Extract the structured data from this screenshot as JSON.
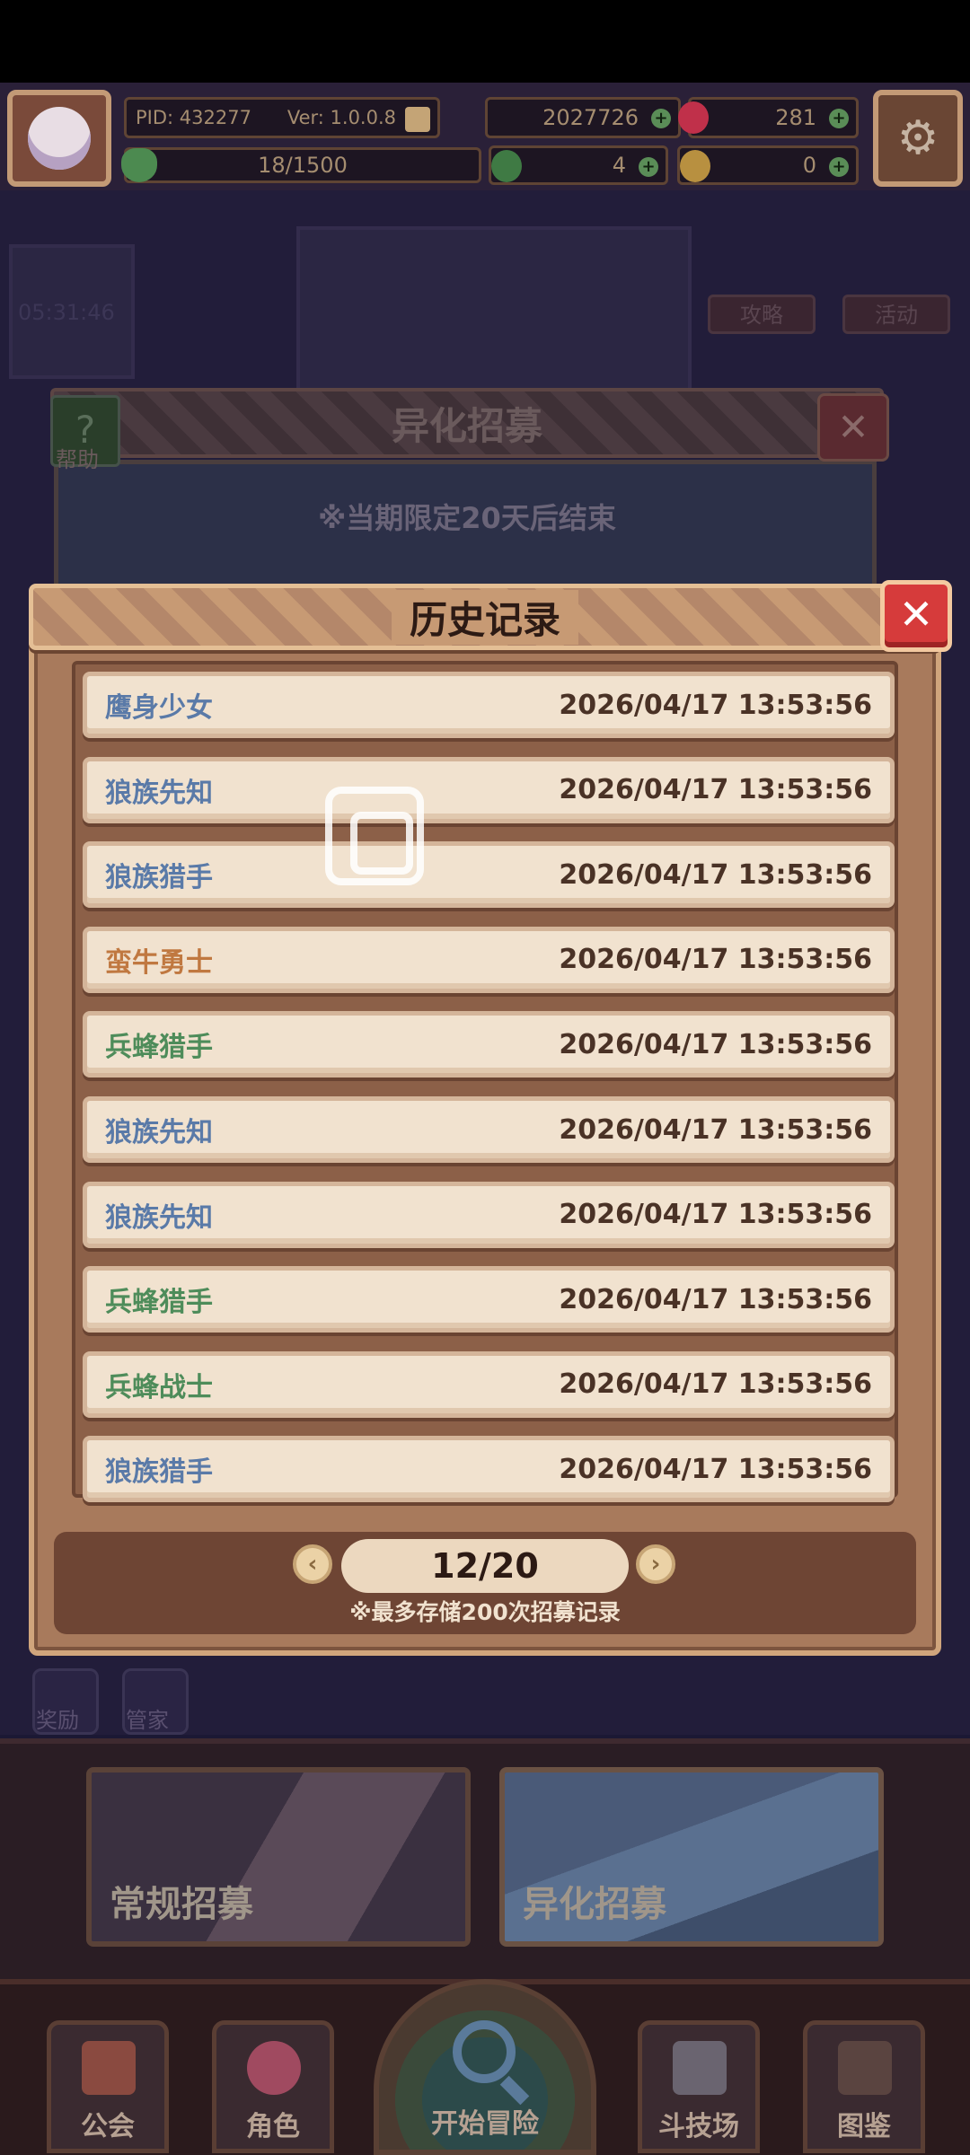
{
  "header": {
    "pid": "PID: 432277",
    "version": "Ver: 1.0.0.8",
    "gold": "2027726",
    "gems": "281",
    "energy": "18/1500",
    "clover": "4",
    "keys": "0",
    "plus": "+"
  },
  "back_dialog": {
    "title": "异化招募",
    "help_label": "帮助",
    "notice": "※当期限定20天后结束",
    "close": "✕",
    "help_icon": "?"
  },
  "history": {
    "title": "历史记录",
    "close": "✕",
    "records": [
      {
        "name": "鹰身少女",
        "time": "2026/04/17 13:53:56",
        "color": "#5a7aa8"
      },
      {
        "name": "狼族先知",
        "time": "2026/04/17 13:53:56",
        "color": "#5a7aa8"
      },
      {
        "name": "狼族猎手",
        "time": "2026/04/17 13:53:56",
        "color": "#5a7aa8"
      },
      {
        "name": "蛮牛勇士",
        "time": "2026/04/17 13:53:56",
        "color": "#c07840"
      },
      {
        "name": "兵蜂猎手",
        "time": "2026/04/17 13:53:56",
        "color": "#4e8c5a"
      },
      {
        "name": "狼族先知",
        "time": "2026/04/17 13:53:56",
        "color": "#5a7aa8"
      },
      {
        "name": "狼族先知",
        "time": "2026/04/17 13:53:56",
        "color": "#5a7aa8"
      },
      {
        "name": "兵蜂猎手",
        "time": "2026/04/17 13:53:56",
        "color": "#4e8c5a"
      },
      {
        "name": "兵蜂战士",
        "time": "2026/04/17 13:53:56",
        "color": "#4e8c5a"
      },
      {
        "name": "狼族猎手",
        "time": "2026/04/17 13:53:56",
        "color": "#5a7aa8"
      }
    ],
    "page": "12/20",
    "prev": "‹",
    "next": "›",
    "note": "※最多存储200次招募记录"
  },
  "scene": {
    "timer": "05:31:46",
    "guide": "攻略",
    "event": "活动",
    "lower_left": "奖励",
    "lower_mid": "管家"
  },
  "recruit": {
    "normal": "常规招募",
    "alien": "异化招募"
  },
  "nav": {
    "guild": "公会",
    "character": "角色",
    "adventure": "开始冒险",
    "arena": "斗技场",
    "codex": "图鉴"
  },
  "colors": {
    "blue_rarity": "#5a7aa8",
    "orange_rarity": "#c07840",
    "green_rarity": "#4e8c5a",
    "accent_close": "#d63b3b"
  }
}
